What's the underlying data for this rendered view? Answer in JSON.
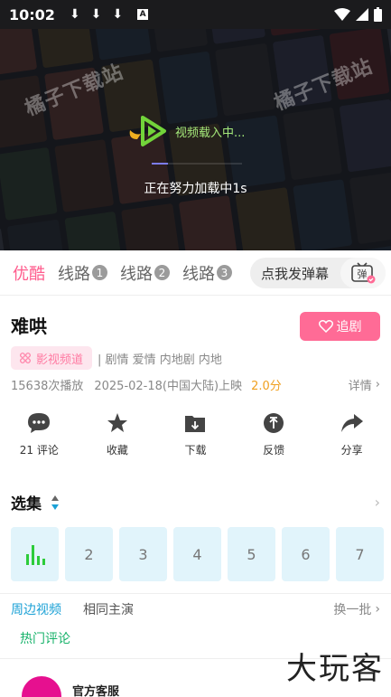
{
  "status_bar": {
    "time": "10:02"
  },
  "video": {
    "watermark": "橘子下载站",
    "loading_label": "视频载入中...",
    "loading_progress": 0.18,
    "status_text": "正在努力加载中1s"
  },
  "source_tabs": [
    {
      "label": "优酷",
      "badge": ""
    },
    {
      "label": "线路",
      "badge": "1"
    },
    {
      "label": "线路",
      "badge": "2"
    },
    {
      "label": "线路",
      "badge": "3"
    }
  ],
  "danmu": {
    "label": "点我发弹幕",
    "icon_text": "弹"
  },
  "show": {
    "title": "难哄",
    "follow_label": "追剧",
    "channel_chip": "影视频道",
    "genres": "| 剧情 爱情 内地剧 内地",
    "plays": "15638次播放",
    "release": "2025-02-18(中国大陆)上映",
    "score": "2.0分",
    "detail_label": "详情"
  },
  "actions": [
    {
      "label": "21 评论",
      "icon": "comment-icon"
    },
    {
      "label": "收藏",
      "icon": "star-icon"
    },
    {
      "label": "下载",
      "icon": "download-icon"
    },
    {
      "label": "反馈",
      "icon": "feedback-icon"
    },
    {
      "label": "分享",
      "icon": "share-icon"
    }
  ],
  "episodes": {
    "header": "选集",
    "items": [
      "",
      "2",
      "3",
      "4",
      "5",
      "6",
      "7"
    ]
  },
  "related": {
    "tab_on": "周边视频",
    "tab_off": "相同主演",
    "refresh_label": "换一批",
    "hot_comments": "热门评论"
  },
  "customer_service": {
    "name": "官方客服"
  },
  "corner_watermark": "大玩客",
  "colors": {
    "accent_pink": "#ff6b96",
    "accent_blue": "#1ba1d6",
    "accent_green": "#17b26a",
    "score_orange": "#f0a020"
  }
}
